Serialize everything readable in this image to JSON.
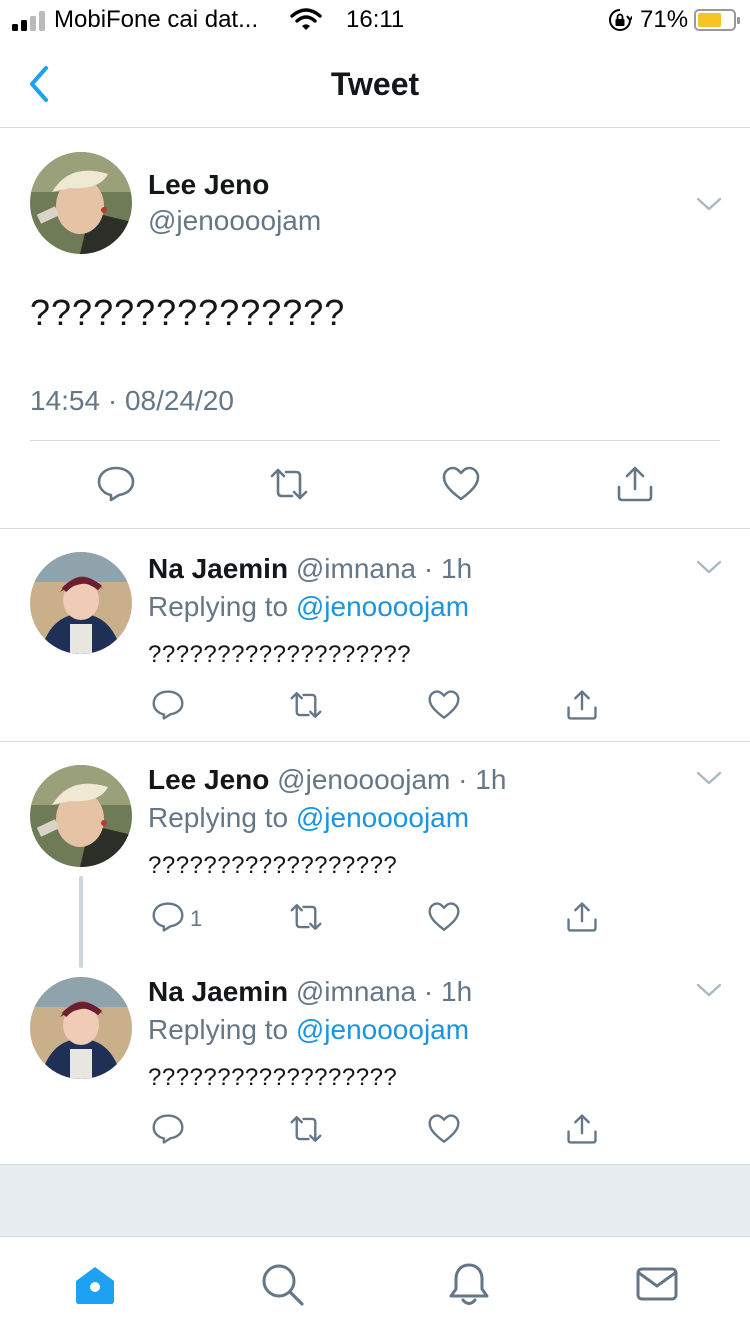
{
  "status_bar": {
    "carrier": "MobiFone cai dat...",
    "time": "16:11",
    "battery_percent": "71%",
    "battery_level": 0.71,
    "icons": [
      "signal-icon",
      "wifi-icon",
      "orientation-lock-icon",
      "battery-icon"
    ]
  },
  "nav": {
    "title": "Tweet",
    "back_icon": "chevron-left-icon"
  },
  "main_tweet": {
    "name": "Lee Jeno",
    "handle": "@jenoooojam",
    "text": "???????????????",
    "timestamp": "14:54 · 08/24/20"
  },
  "replies": [
    {
      "name": "Na Jaemin",
      "meta": "@imnana · 1h",
      "replying_prefix": "Replying to",
      "mention": "@jenoooojam",
      "text": "???????????????????"
    },
    {
      "name": "Lee Jeno",
      "meta": "@jenoooojam · 1h",
      "replying_prefix": "Replying to",
      "mention": "@jenoooojam",
      "text": "??????????????????",
      "reply_count": "1"
    },
    {
      "name": "Na Jaemin",
      "meta": "@imnana · 1h",
      "replying_prefix": "Replying to",
      "mention": "@jenoooojam",
      "text": "??????????????????"
    }
  ],
  "colors": {
    "accent": "#1da1f2",
    "mention": "#1b95e0",
    "secondary_text": "#657786",
    "divider": "#d6dbe0"
  },
  "tab_bar": [
    "home-icon",
    "search-icon",
    "notifications-icon",
    "messages-icon"
  ]
}
